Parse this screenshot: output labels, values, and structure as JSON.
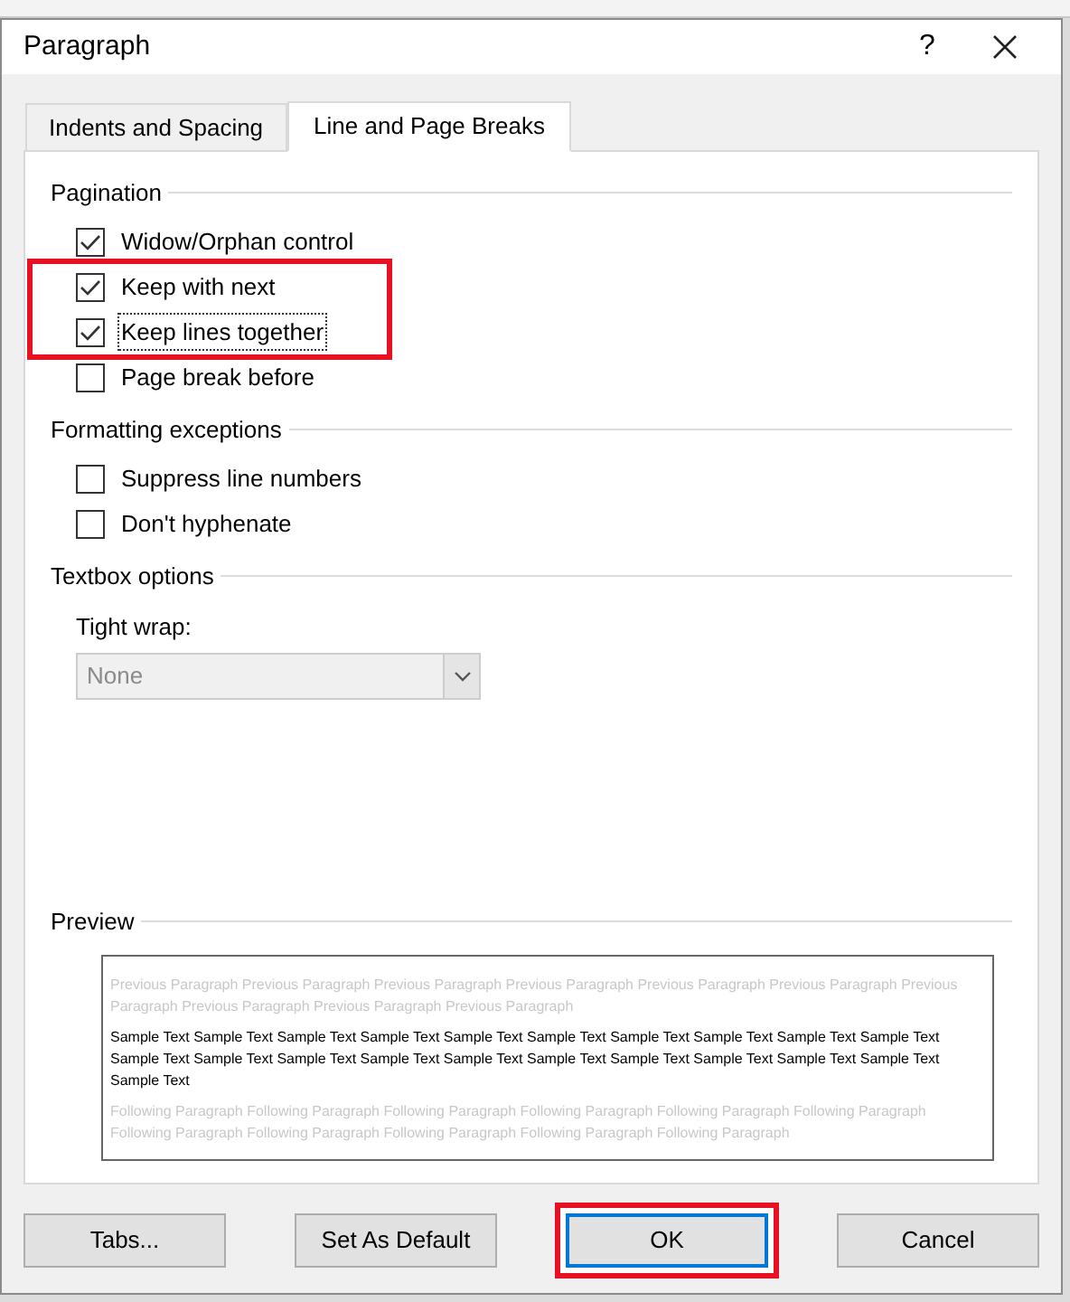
{
  "window": {
    "title": "Paragraph",
    "help": "?"
  },
  "tabs": [
    {
      "label": "Indents and Spacing",
      "selected": false
    },
    {
      "label": "Line and Page Breaks",
      "selected": true
    }
  ],
  "sections": [
    {
      "title": "Pagination",
      "options": [
        {
          "kind": "checkbox",
          "label": "Widow/Orphan control",
          "checked": true,
          "highlighted": false,
          "focused": false
        },
        {
          "kind": "checkbox",
          "label": "Keep with next",
          "checked": true,
          "highlighted": true,
          "focused": false
        },
        {
          "kind": "checkbox",
          "label": "Keep lines together",
          "checked": true,
          "highlighted": true,
          "focused": true
        },
        {
          "kind": "checkbox",
          "label": "Page break before",
          "checked": false,
          "highlighted": false,
          "focused": false
        }
      ]
    },
    {
      "title": "Formatting exceptions",
      "options": [
        {
          "kind": "checkbox",
          "label": "Suppress line numbers",
          "checked": false,
          "highlighted": false,
          "focused": false
        },
        {
          "kind": "checkbox",
          "label": "Don't hyphenate",
          "checked": false,
          "highlighted": false,
          "focused": false
        }
      ]
    },
    {
      "title": "Textbox options",
      "options": [
        {
          "kind": "dropdown",
          "label": "Tight wrap:",
          "value": "None",
          "disabled": true
        }
      ]
    }
  ],
  "preview": {
    "title": "Preview",
    "previous": "Previous Paragraph Previous Paragraph Previous Paragraph Previous Paragraph Previous Paragraph Previous Paragraph Previous Paragraph Previous Paragraph Previous Paragraph Previous Paragraph",
    "sample": "Sample Text Sample Text Sample Text Sample Text Sample Text Sample Text Sample Text Sample Text Sample Text Sample Text Sample Text Sample Text Sample Text Sample Text Sample Text Sample Text Sample Text Sample Text Sample Text Sample Text Sample Text",
    "following": "Following Paragraph Following Paragraph Following Paragraph Following Paragraph Following Paragraph Following Paragraph Following Paragraph Following Paragraph Following Paragraph Following Paragraph Following Paragraph"
  },
  "buttons": [
    {
      "label": "Tabs...",
      "highlighted": false,
      "focused": false
    },
    {
      "label": "Set As Default",
      "highlighted": false,
      "focused": false
    },
    {
      "label": "OK",
      "highlighted": true,
      "focused": true
    },
    {
      "label": "Cancel",
      "highlighted": false,
      "focused": false
    }
  ]
}
